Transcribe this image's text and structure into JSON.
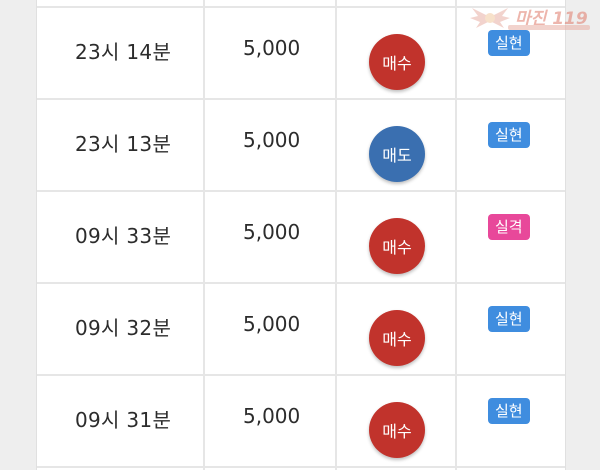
{
  "colors": {
    "buy": "#c1332c",
    "sell": "#3a6fb0",
    "success": "#3f8ddf",
    "fail": "#e8489a"
  },
  "watermark": {
    "text": "마진 119"
  },
  "rows": [
    {
      "time": "23시 14분",
      "amount": "5,000",
      "trade": "매수",
      "trade_type": "buy",
      "result": "실현",
      "result_type": "success"
    },
    {
      "time": "23시 13분",
      "amount": "5,000",
      "trade": "매도",
      "trade_type": "sell",
      "result": "실현",
      "result_type": "success"
    },
    {
      "time": "09시 33분",
      "amount": "5,000",
      "trade": "매수",
      "trade_type": "buy",
      "result": "실격",
      "result_type": "fail"
    },
    {
      "time": "09시 32분",
      "amount": "5,000",
      "trade": "매수",
      "trade_type": "buy",
      "result": "실현",
      "result_type": "success"
    },
    {
      "time": "09시 31분",
      "amount": "5,000",
      "trade": "매수",
      "trade_type": "buy",
      "result": "실현",
      "result_type": "success"
    }
  ]
}
